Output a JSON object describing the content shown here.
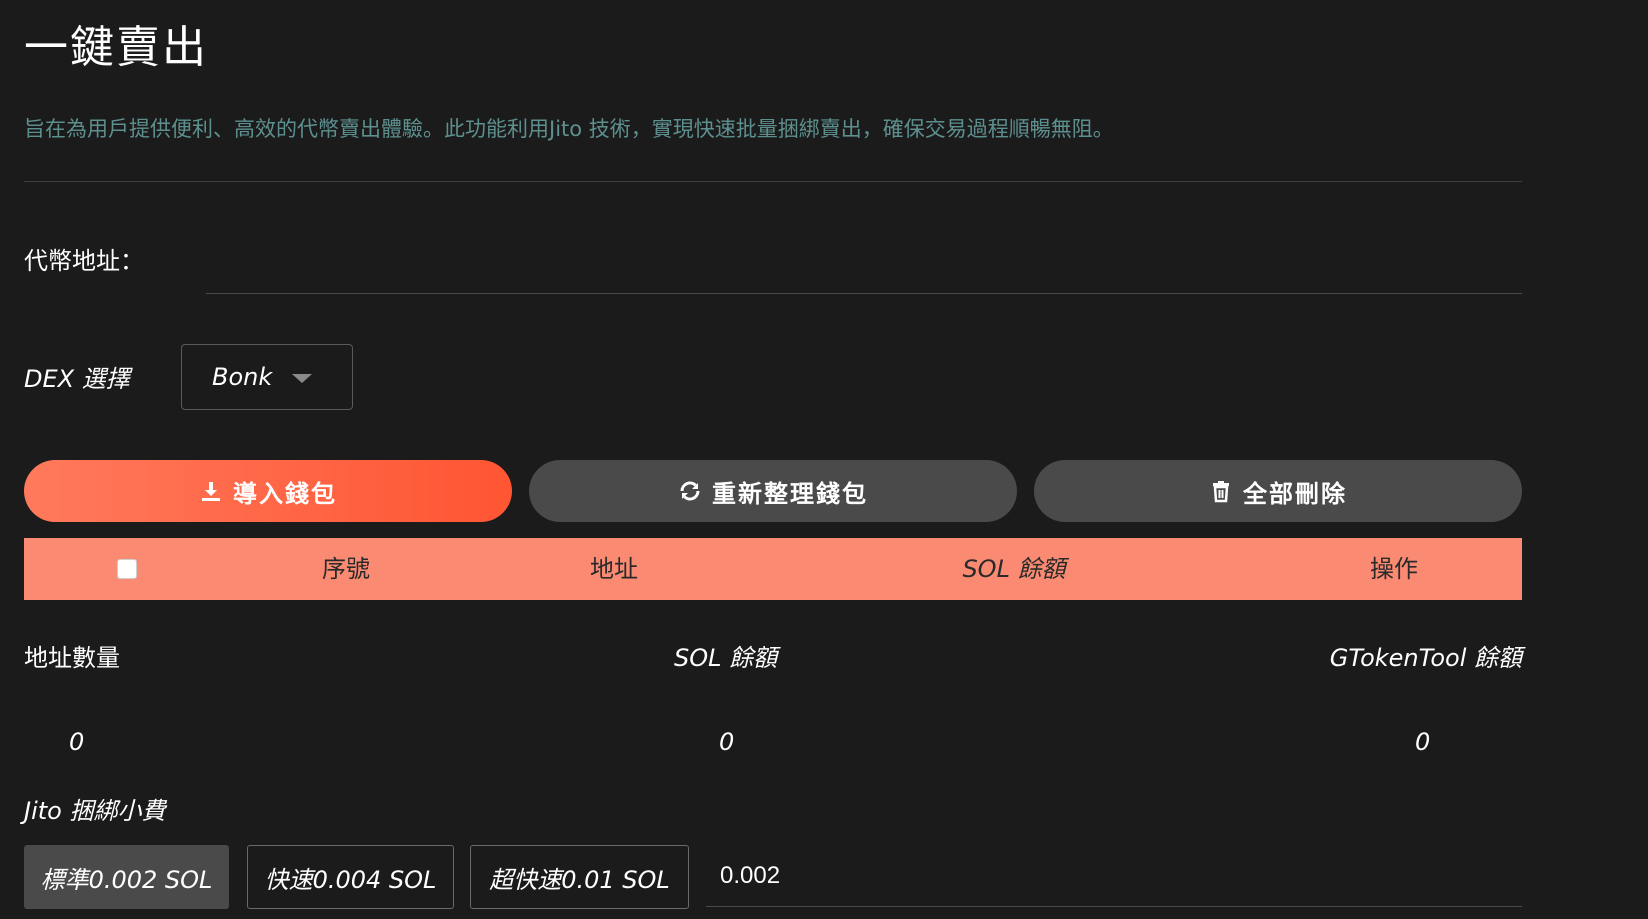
{
  "page": {
    "title": "一鍵賣出",
    "description": "旨在為用戶提供便利、高效的代幣賣出體驗。此功能利用Jito 技術，實現快速批量捆綁賣出，確保交易過程順暢無阻。"
  },
  "token_address": {
    "label": "代幣地址：",
    "value": "",
    "placeholder": ""
  },
  "dex": {
    "label": "DEX 選擇",
    "selected": "Bonk"
  },
  "actions": {
    "import_wallet": "導入錢包",
    "refresh_wallet": "重新整理錢包",
    "delete_all": "全部刪除"
  },
  "table": {
    "columns": [
      "序號",
      "地址",
      "SOL 餘額",
      "操作"
    ],
    "rows": []
  },
  "stats": {
    "address_count_label": "地址數量",
    "address_count_value": "0",
    "sol_balance_label": "SOL 餘額",
    "sol_balance_value": "0",
    "gtoken_balance_label": "GTokenTool 餘額",
    "gtoken_balance_value": "0"
  },
  "jito_fee": {
    "label": "Jito 捆綁小費",
    "options": [
      "標準0.002 SOL",
      "快速0.004 SOL",
      "超快速0.01 SOL"
    ],
    "selected_index": 0,
    "value": "0.002"
  },
  "colors": {
    "background": "#1b1b1b",
    "accent": "#ff5533",
    "table_header": "#fb8a73",
    "description_text": "#5e8f8f",
    "secondary_button": "#4a4a4a"
  }
}
